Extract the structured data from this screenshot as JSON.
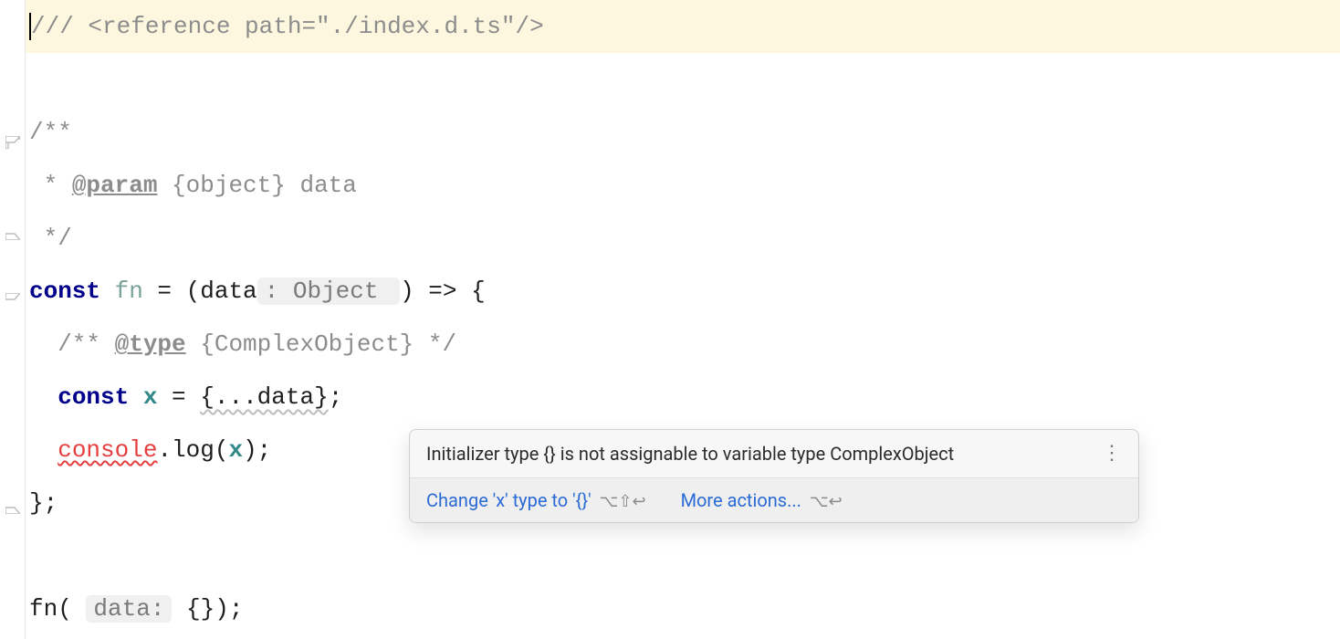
{
  "code": {
    "line1_ref": "/// <reference path=\"./index.d.ts\"/>",
    "line3_open": "/**",
    "line4_star": " * ",
    "line4_tag": "@param",
    "line4_rest": " {object} data",
    "line5_close": " */",
    "line6_const": "const",
    "line6_fn": " fn",
    "line6_eq": " = (data",
    "line6_hint": ": Object ",
    "line6_tail": ") => {",
    "line7_indent": "  /** ",
    "line7_tag": "@type",
    "line7_rest": " {ComplexObject} */",
    "line8_indent": "  ",
    "line8_const": "const",
    "line8_x": " x",
    "line8_eq": " = ",
    "line8_spread": "{...data}",
    "line8_semi": ";",
    "line9_indent": "  ",
    "line9_console": "console",
    "line9_dot": ".log(",
    "line9_x": "x",
    "line9_close": ");",
    "line10_close": "};",
    "line12_fn": "fn( ",
    "line12_hint": "data:",
    "line12_tail": " {});"
  },
  "popup": {
    "message": "Initializer type {} is not assignable to variable type ComplexObject",
    "action1": "Change 'x' type to '{}'",
    "shortcut1": "⌥⇧↩",
    "action2": "More actions...",
    "shortcut2": "⌥↩"
  }
}
